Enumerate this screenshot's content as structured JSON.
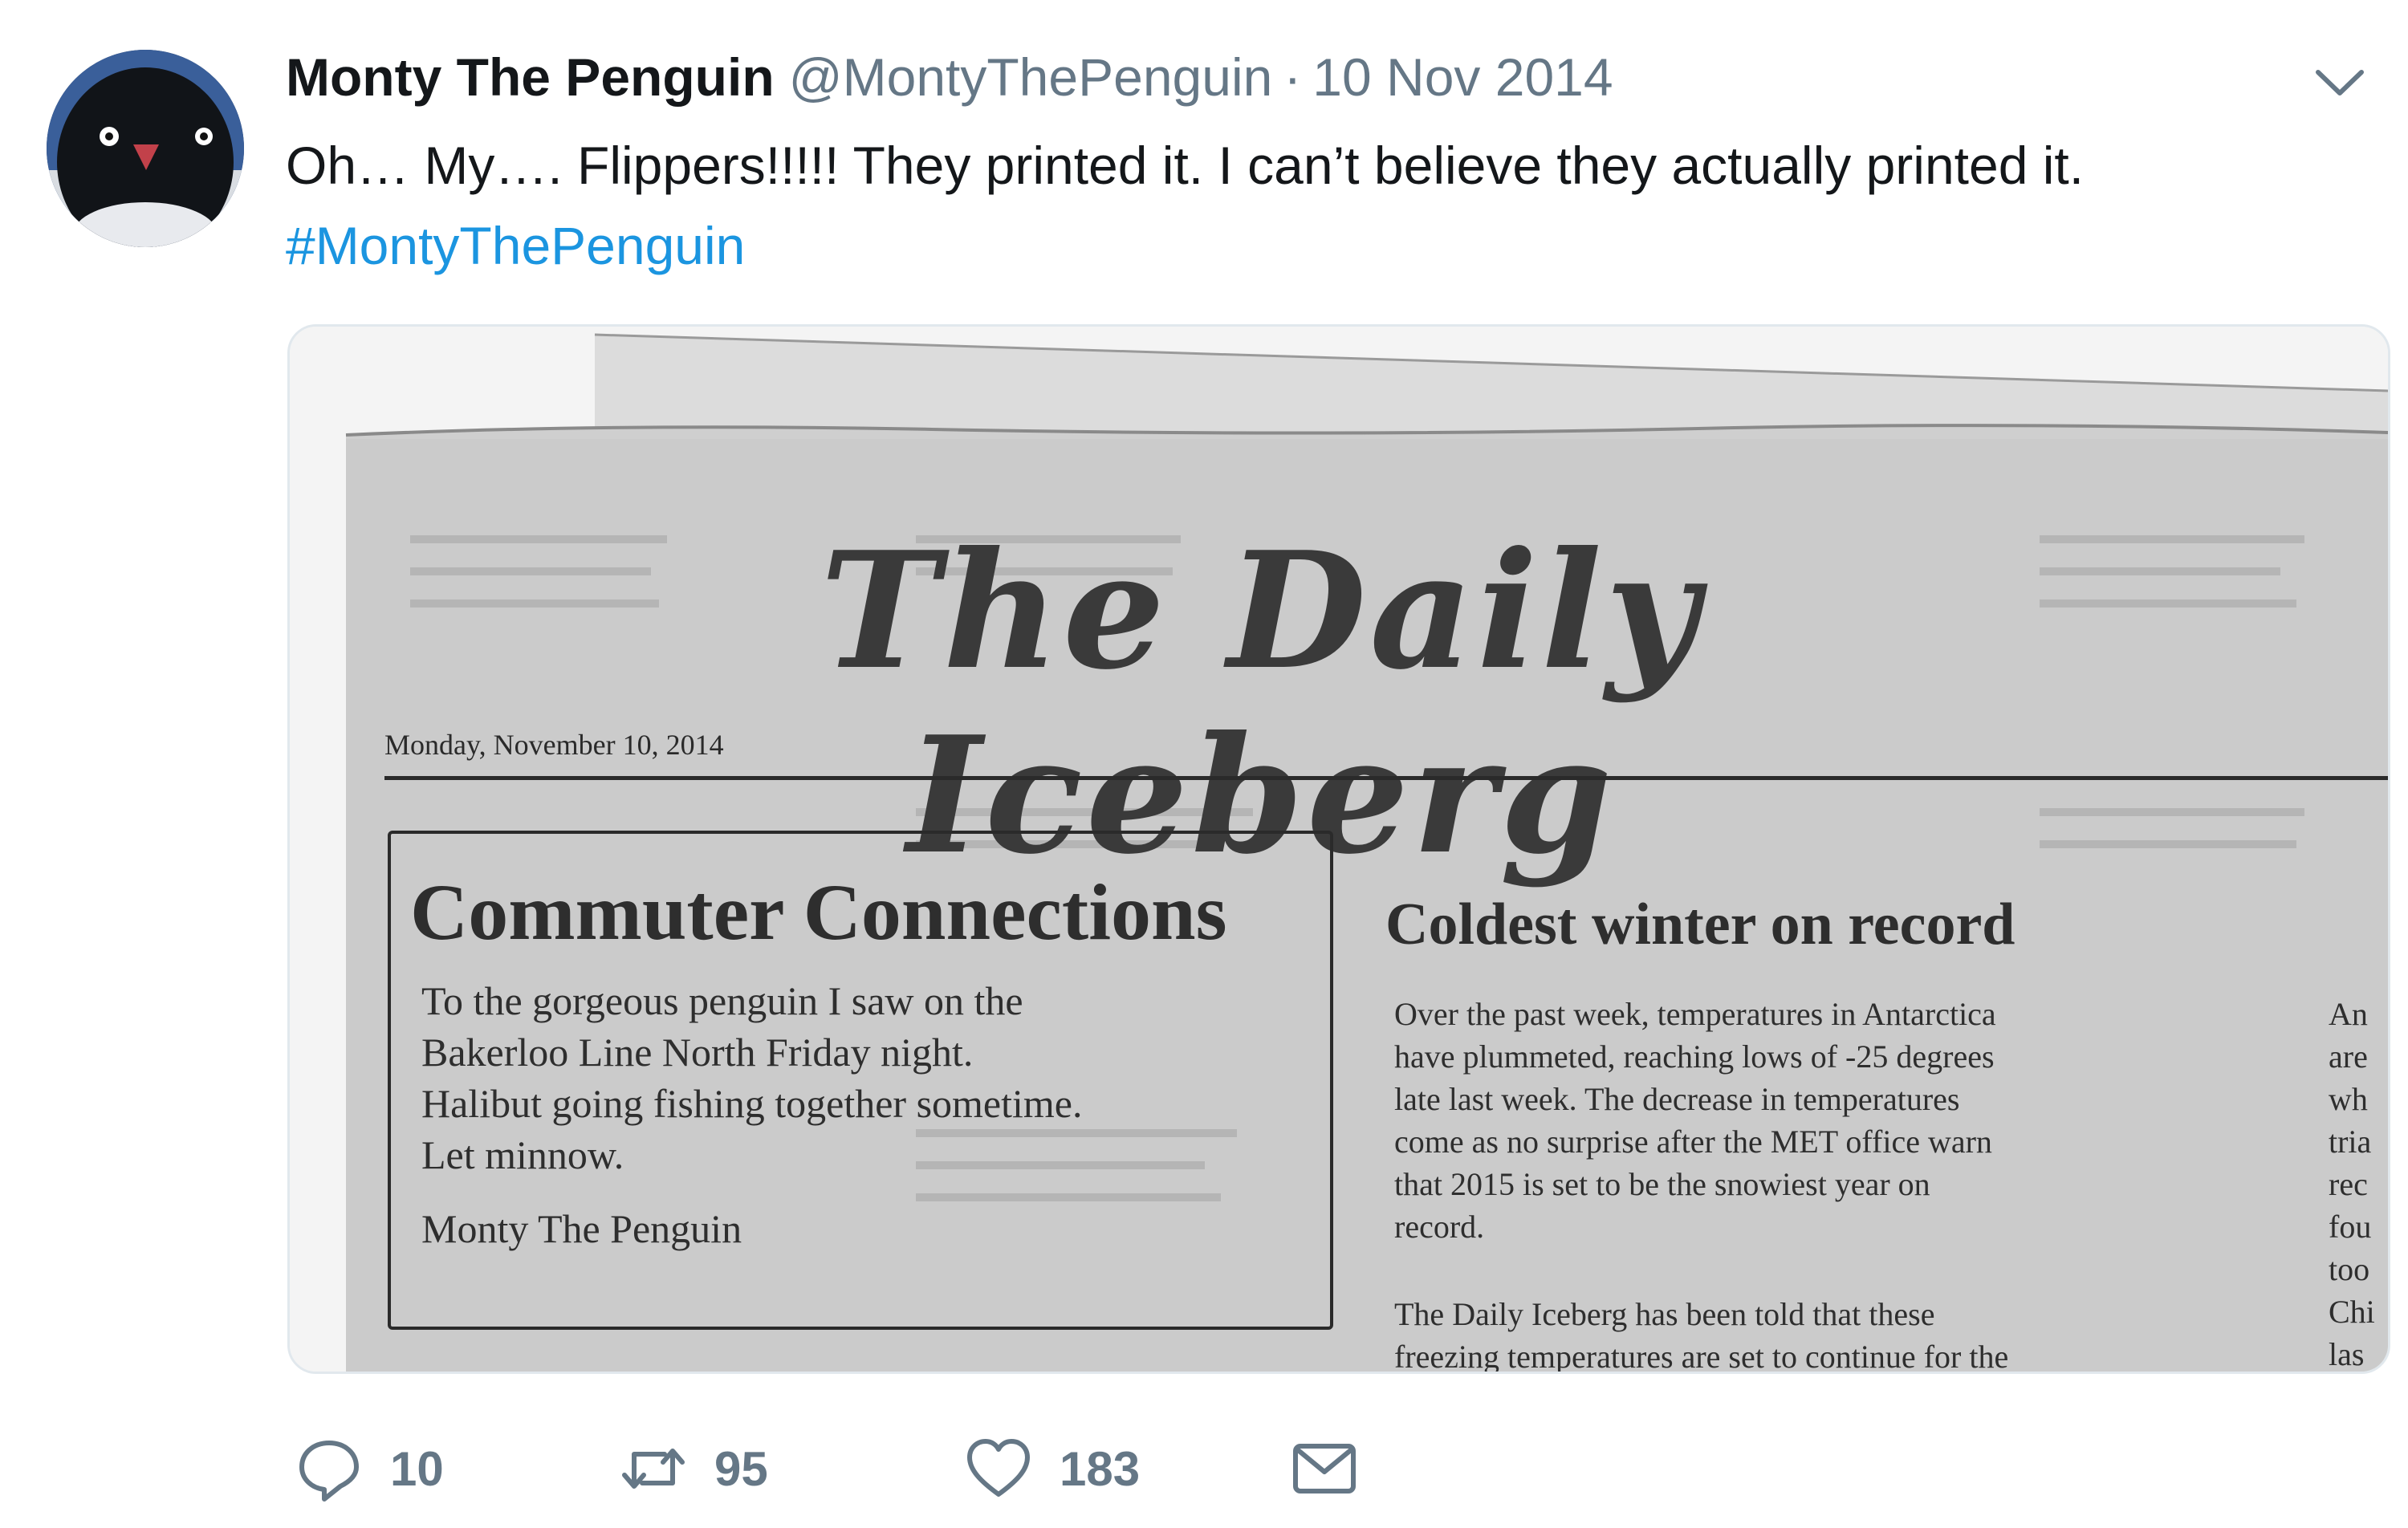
{
  "tweet": {
    "author": {
      "display_name": "Monty The Penguin",
      "handle": "@MontyThePenguin"
    },
    "separator": "·",
    "date": "10 Nov 2014",
    "text": "Oh… My…. Flippers!!!!! They printed it. I can’t believe they actually printed it.",
    "hashtag": "#MontyThePenguin"
  },
  "newspaper": {
    "masthead": "The Daily Iceberg",
    "date_line": "Monday, November 10, 2014",
    "ad_box": {
      "heading": "Commuter Connections",
      "lines": [
        "To the gorgeous penguin I saw on the",
        "Bakerloo Line North Friday night.",
        "Halibut going fishing together sometime.",
        "Let minnow."
      ],
      "signature": "Monty The Penguin"
    },
    "article": {
      "heading": "Coldest winter on record",
      "para1_lines": [
        "Over the past week, temperatures in Antarctica",
        "have plummeted, reaching lows of -25 degrees",
        "late last week. The decrease in temperatures",
        "come as no surprise after the MET office warn",
        "that 2015 is set to be the snowiest year on",
        "record."
      ],
      "para2_lines": [
        "The Daily Iceberg has been told that these",
        "freezing temperatures are set to continue for the"
      ]
    },
    "edge_column": [
      "An",
      "are",
      "wh",
      "tria",
      "rec",
      "fou",
      "too",
      "Chi",
      "las"
    ]
  },
  "actions": {
    "replies": "10",
    "retweets": "95",
    "likes": "183"
  },
  "icons": {
    "more": "chevron-down-icon",
    "reply": "reply-icon",
    "retweet": "retweet-icon",
    "like": "heart-icon",
    "dm": "envelope-icon"
  },
  "colors": {
    "link": "#1b95e0",
    "muted": "#657786",
    "text": "#14171a"
  }
}
